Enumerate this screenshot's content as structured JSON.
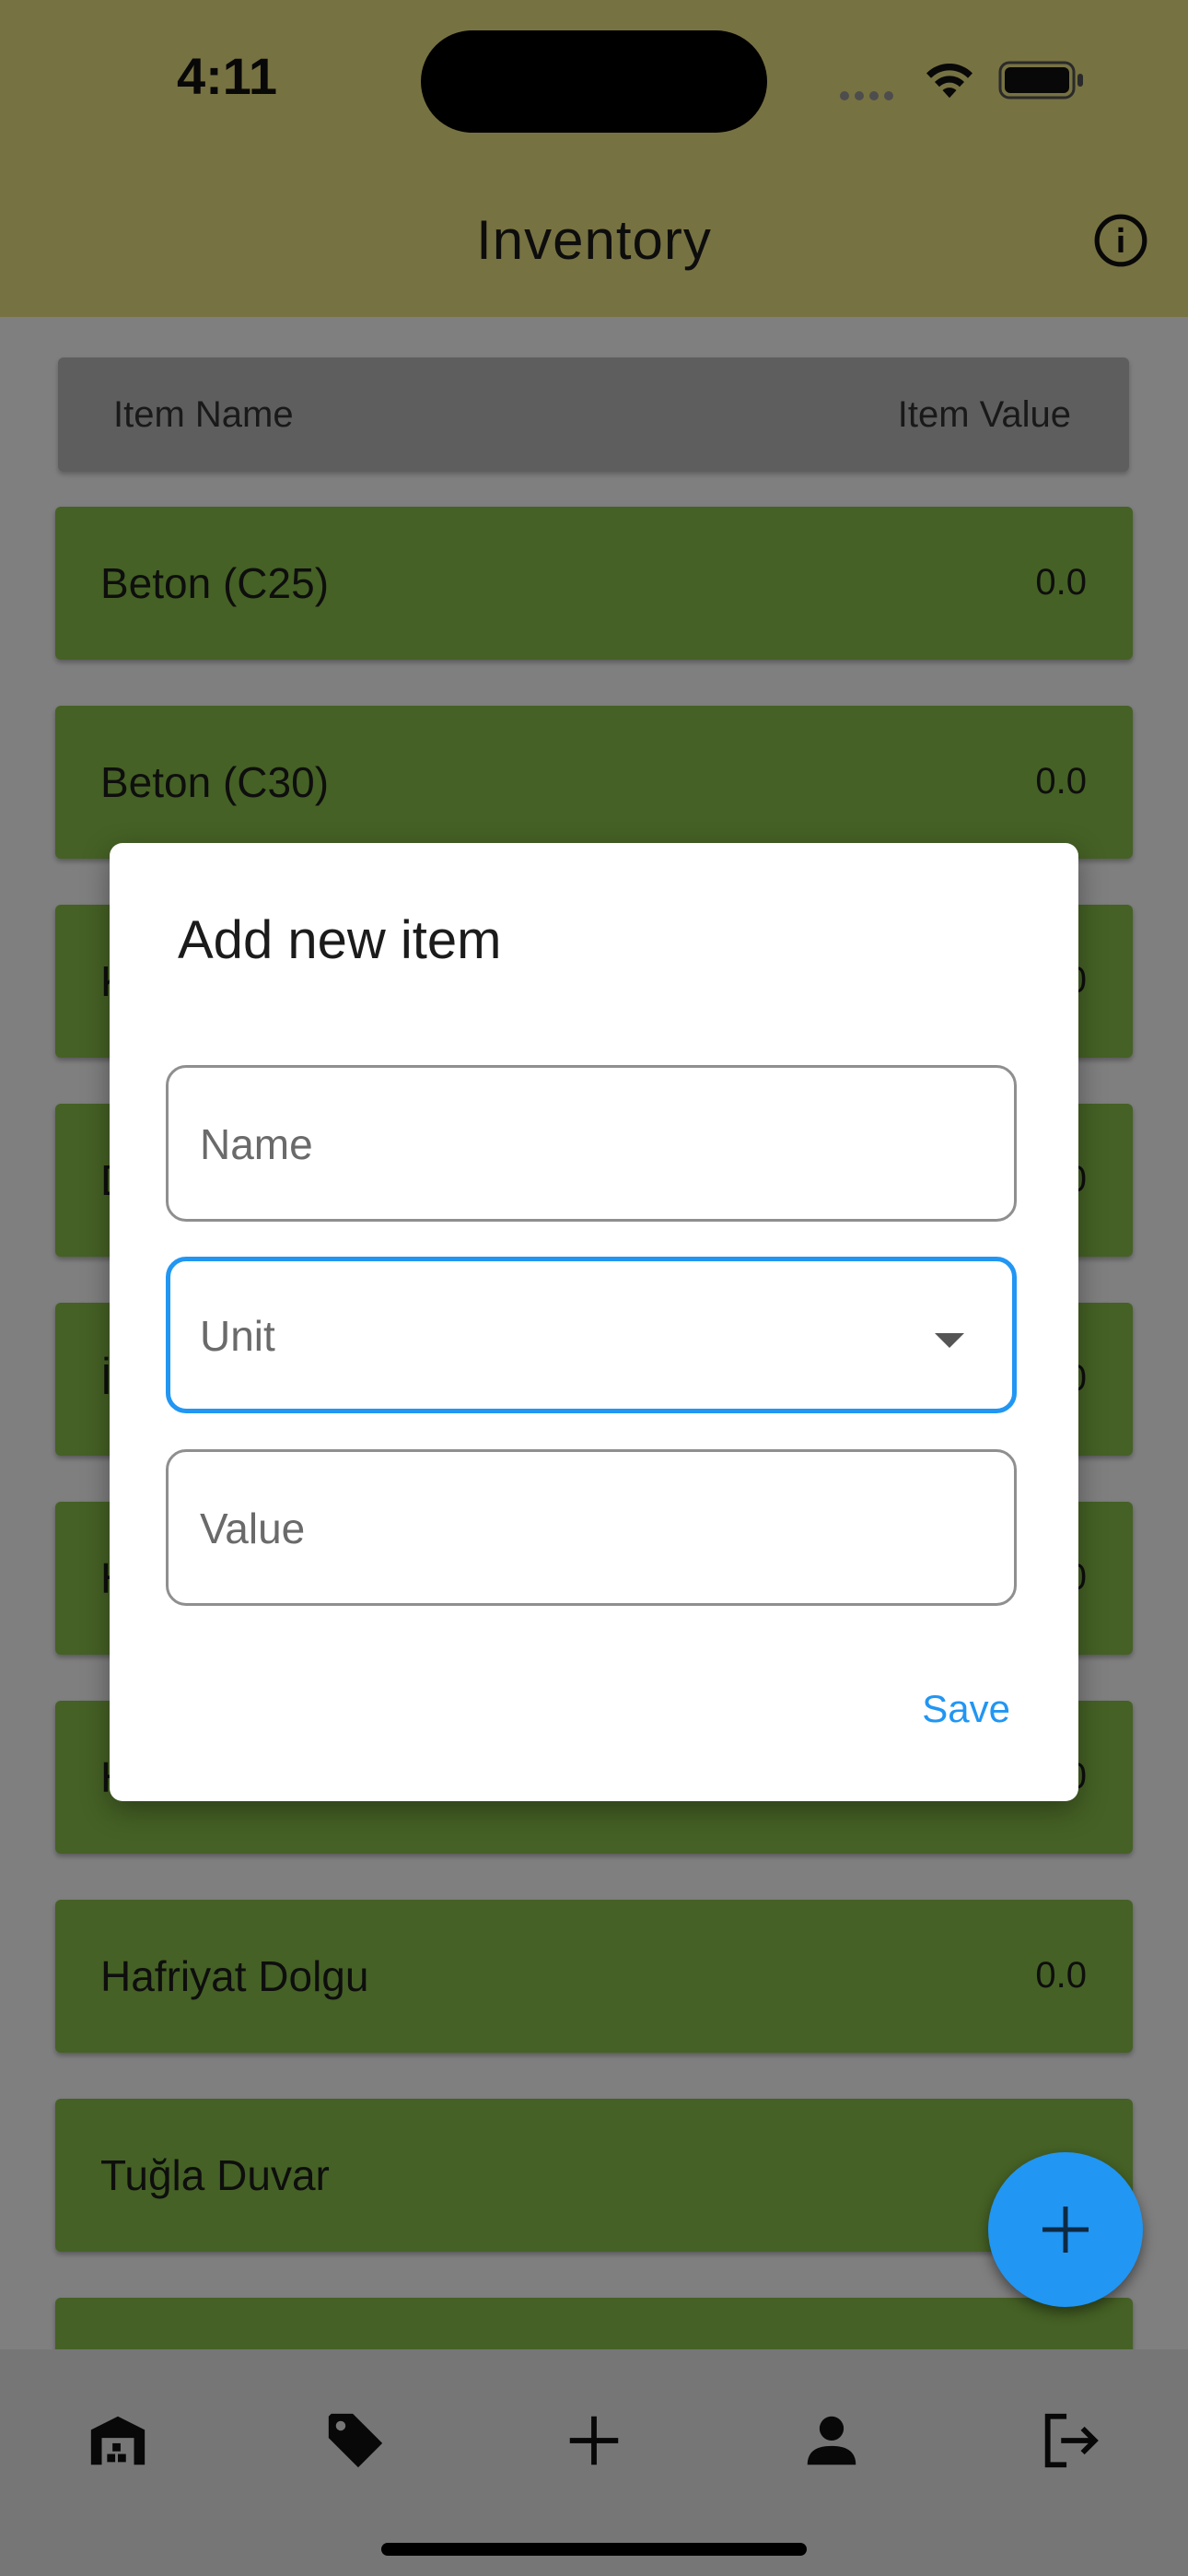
{
  "status_bar": {
    "time": "4:11"
  },
  "app_bar": {
    "title": "Inventory",
    "info_icon": "info-circle-icon"
  },
  "table_header": {
    "name": "Item Name",
    "value": "Item Value"
  },
  "items": [
    {
      "name": "Beton (C25)",
      "value": "0.0"
    },
    {
      "name": "Beton (C30)",
      "value": "0.0"
    },
    {
      "name": "K",
      "value": "0.0"
    },
    {
      "name": "D",
      "value": "0.0"
    },
    {
      "name": "İ",
      "value": "0.0"
    },
    {
      "name": "H",
      "value": "0.0"
    },
    {
      "name": "H",
      "value": "0.0"
    },
    {
      "name": "Hafriyat Dolgu",
      "value": "0.0"
    },
    {
      "name": "Tuğla Duvar",
      "value": ""
    }
  ],
  "dialog": {
    "title": "Add new item",
    "name_placeholder": "Name",
    "unit_placeholder": "Unit",
    "value_placeholder": "Value",
    "save_label": "Save"
  },
  "fab": {
    "icon": "plus-icon"
  },
  "bottom_nav": {
    "items": [
      "warehouse-icon",
      "tag-icon",
      "plus-icon",
      "person-icon",
      "logout-icon"
    ]
  }
}
